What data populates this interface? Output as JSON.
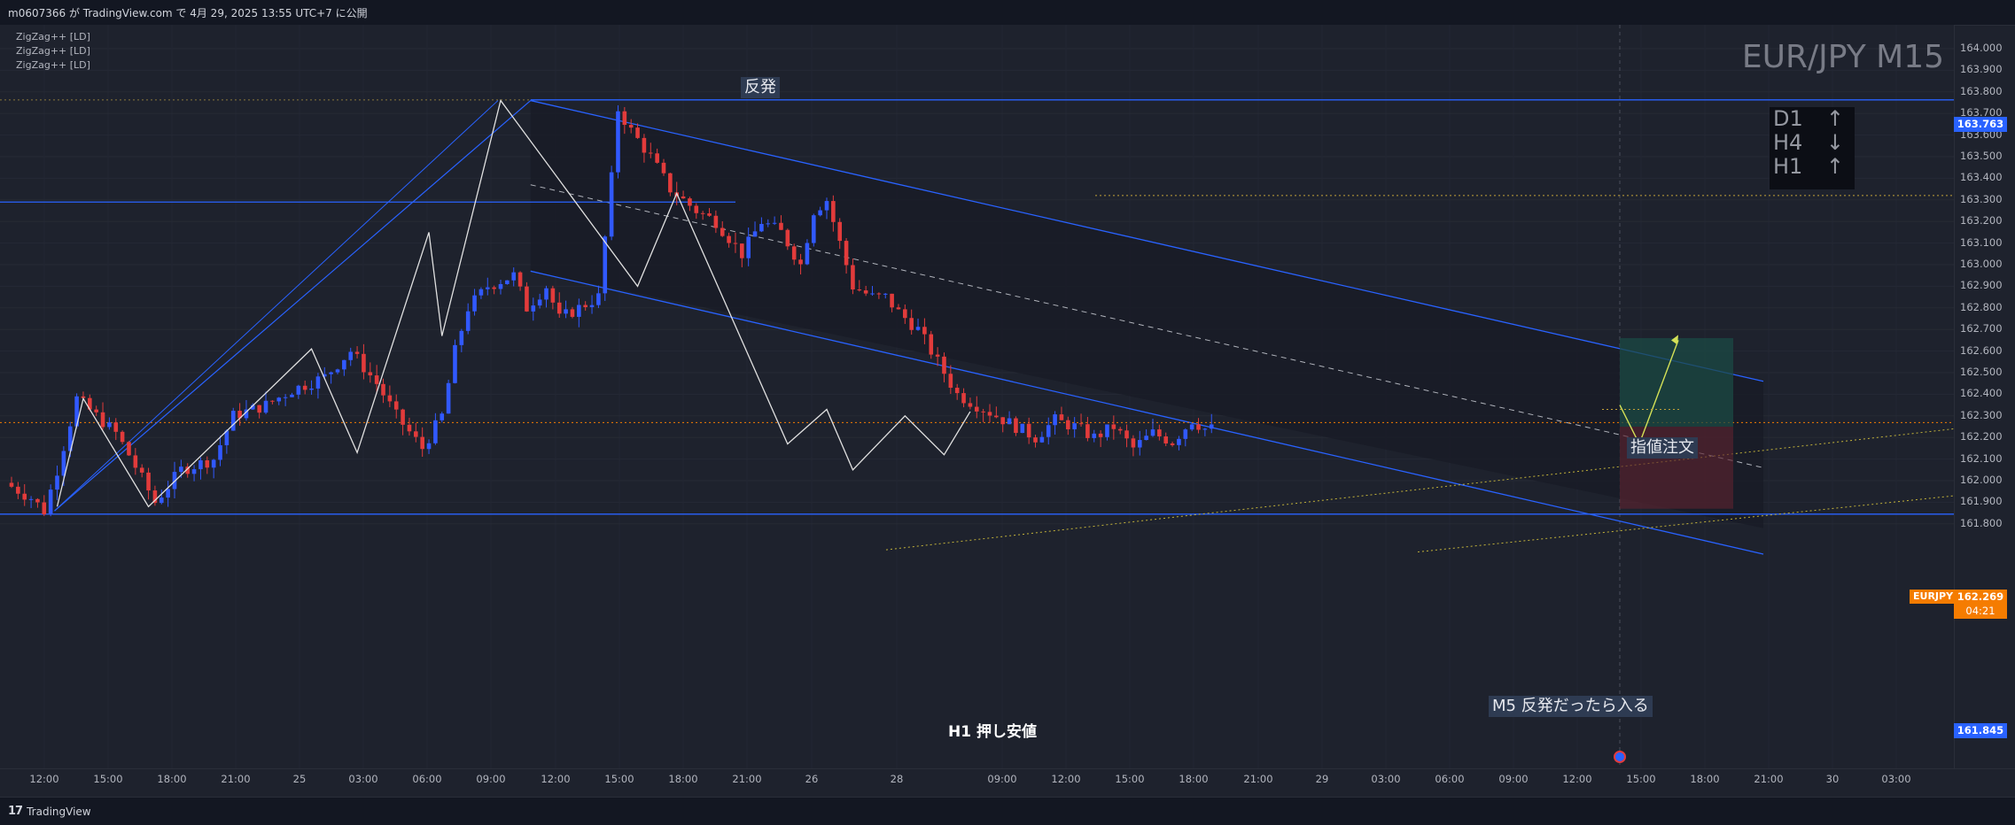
{
  "header": {
    "publish_text": "m0607366 が TradingView.com で 4月 29, 2025 13:55 UTC+7 に公開"
  },
  "footer": {
    "brand": "TradingView",
    "logo_icon": "tradingview-logo-icon"
  },
  "legend": [
    "ZigZag++ [LD]",
    "ZigZag++ [LD]",
    "ZigZag++ [LD]"
  ],
  "symbol": {
    "title": "EUR/JPY M15",
    "ticker": "EURJPY",
    "last_price": "162.269",
    "countdown": "04:21"
  },
  "trend_box": [
    {
      "tf": "D1",
      "arrow": "↑"
    },
    {
      "tf": "H4",
      "arrow": "↓"
    },
    {
      "tf": "H1",
      "arrow": "↑"
    }
  ],
  "annotations": {
    "rebound": "反発",
    "limit_order": "指値注文",
    "m5_entry": "M5 反発だったら入る",
    "h1_support": "H1 押し安値"
  },
  "price_labels": {
    "resistance": "163.763",
    "support": "161.845"
  },
  "colors": {
    "bull": "#3159ff",
    "bear": "#e23b3b",
    "line_blue": "#2962ff",
    "zigzag": "#e0e0e0",
    "target": "#d4e157",
    "last_price_bg": "#f57c00",
    "level_blue": "#2962ff"
  },
  "chart_data": {
    "type": "candlestick",
    "title": "EUR/JPY M15",
    "ylim": [
      161.75,
      164.05
    ],
    "y_ticks": [
      "164.000",
      "163.900",
      "163.800",
      "163.700",
      "163.600",
      "163.500",
      "163.400",
      "163.300",
      "163.200",
      "163.100",
      "163.000",
      "162.900",
      "162.800",
      "162.700",
      "162.600",
      "162.500",
      "162.400",
      "162.300",
      "162.200",
      "162.100",
      "162.000",
      "161.900",
      "161.800"
    ],
    "x_ticks": [
      "12:00",
      "15:00",
      "18:00",
      "21:00",
      "25",
      "03:00",
      "06:00",
      "09:00",
      "12:00",
      "15:00",
      "18:00",
      "21:00",
      "26",
      "28",
      "09:00",
      "12:00",
      "15:00",
      "18:00",
      "21:00",
      "29",
      "03:00",
      "06:00",
      "09:00",
      "12:00",
      "15:00",
      "18:00",
      "21:00",
      "30",
      "03:00"
    ],
    "price_path": [
      [
        0,
        161.99
      ],
      [
        4,
        161.92
      ],
      [
        6,
        161.86
      ],
      [
        8,
        162.05
      ],
      [
        11,
        162.38
      ],
      [
        14,
        162.3
      ],
      [
        17,
        162.22
      ],
      [
        19,
        162.12
      ],
      [
        23,
        161.9
      ],
      [
        27,
        162.05
      ],
      [
        32,
        162.1
      ],
      [
        35,
        162.3
      ],
      [
        40,
        162.35
      ],
      [
        44,
        162.42
      ],
      [
        49,
        162.48
      ],
      [
        53,
        162.6
      ],
      [
        57,
        162.45
      ],
      [
        60,
        162.3
      ],
      [
        64,
        162.15
      ],
      [
        67,
        162.3
      ],
      [
        69,
        162.6
      ],
      [
        71,
        162.8
      ],
      [
        74,
        162.9
      ],
      [
        78,
        162.95
      ],
      [
        80,
        162.8
      ],
      [
        83,
        162.9
      ],
      [
        85,
        162.75
      ],
      [
        88,
        162.8
      ],
      [
        91,
        162.85
      ],
      [
        93,
        163.4
      ],
      [
        94,
        163.72
      ],
      [
        96,
        163.62
      ],
      [
        99,
        163.5
      ],
      [
        102,
        163.35
      ],
      [
        106,
        163.25
      ],
      [
        109,
        163.2
      ],
      [
        113,
        163.05
      ],
      [
        116,
        163.2
      ],
      [
        119,
        163.15
      ],
      [
        122,
        163.0
      ],
      [
        124,
        163.25
      ],
      [
        126,
        163.3
      ],
      [
        128,
        163.1
      ],
      [
        130,
        162.9
      ],
      [
        133,
        162.85
      ],
      [
        135,
        162.85
      ],
      [
        137,
        162.78
      ],
      [
        140,
        162.7
      ],
      [
        143,
        162.55
      ],
      [
        146,
        162.4
      ],
      [
        149,
        162.35
      ],
      [
        152,
        162.3
      ],
      [
        155,
        162.25
      ],
      [
        158,
        162.2
      ],
      [
        161,
        162.28
      ],
      [
        164,
        162.25
      ],
      [
        167,
        162.2
      ],
      [
        170,
        162.25
      ],
      [
        173,
        162.15
      ],
      [
        176,
        162.22
      ],
      [
        179,
        162.18
      ],
      [
        182,
        162.28
      ],
      [
        184,
        162.24
      ]
    ],
    "zigzag_points": [
      [
        7,
        161.88
      ],
      [
        11,
        162.38
      ],
      [
        21,
        161.88
      ],
      [
        46,
        162.61
      ],
      [
        53,
        162.13
      ],
      [
        64,
        163.15
      ],
      [
        66,
        162.67
      ],
      [
        75,
        163.76
      ],
      [
        96,
        162.9
      ],
      [
        102,
        163.33
      ],
      [
        119,
        162.17
      ],
      [
        125,
        162.33
      ],
      [
        129,
        162.05
      ],
      [
        137,
        162.3
      ],
      [
        143,
        162.12
      ],
      [
        147,
        162.32
      ]
    ],
    "levels": {
      "resistance": 163.763,
      "support": 161.845,
      "last": 162.269
    },
    "trade_plan": {
      "entry": 162.25,
      "target": 162.66,
      "stop": 161.87,
      "path": [
        [
          0,
          162.35
        ],
        [
          1,
          162.17
        ],
        [
          3,
          162.65
        ]
      ]
    }
  }
}
